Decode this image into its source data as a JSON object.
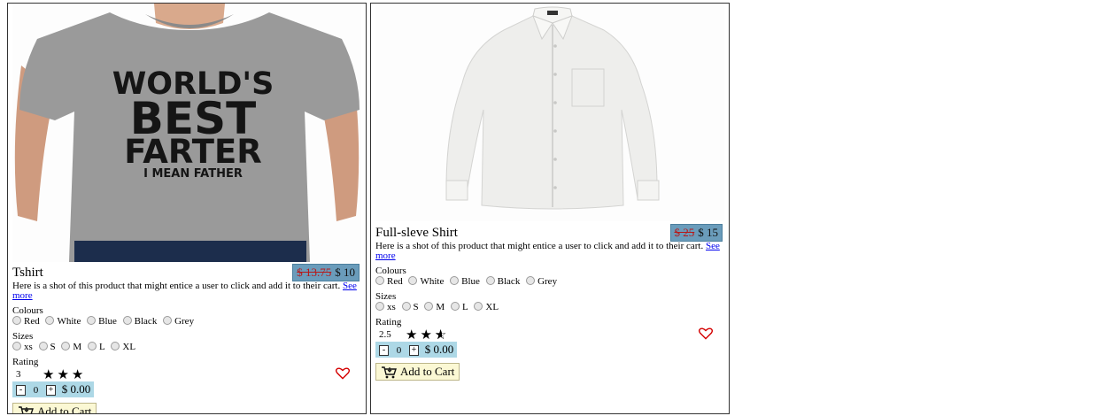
{
  "products": [
    {
      "title": "Tshirt",
      "price_old": "$ 13.75",
      "price_new": "$ 10",
      "description": "Here is a shot of this product that might entice a user to click and add it to their cart.",
      "see_more": "See more",
      "colours_label": "Colours",
      "colours": [
        "Red",
        "White",
        "Blue",
        "Black",
        "Grey"
      ],
      "sizes_label": "Sizes",
      "sizes": [
        "xs",
        "S",
        "M",
        "L",
        "XL"
      ],
      "rating_label": "Rating",
      "rating_value": "3",
      "quantity": "0",
      "total": "$ 0.00",
      "cart_label": "Add to Cart",
      "image_icon": "grey-tshirt-photo",
      "shirt_text": [
        "WORLD'S",
        "BEST",
        "FARTER",
        "I MEAN FATHER"
      ]
    },
    {
      "title": "Full-sleve Shirt",
      "price_old": "$ 25",
      "price_new": "$ 15",
      "description": "Here is a shot of this product that might entice a user to click and add it to their cart.",
      "see_more": "See more",
      "colours_label": "Colours",
      "colours": [
        "Red",
        "White",
        "Blue",
        "Black",
        "Grey"
      ],
      "sizes_label": "Sizes",
      "sizes": [
        "xs",
        "S",
        "M",
        "L",
        "XL"
      ],
      "rating_label": "Rating",
      "rating_value": "2.5",
      "quantity": "0",
      "total": "$ 0.00",
      "cart_label": "Add to Cart",
      "image_icon": "white-shirt-photo"
    }
  ],
  "colors": {
    "price_badge": "#6a9cbb",
    "old_price": "#b81818",
    "qty_bar": "#add8e6",
    "cart_button": "#fbf8d4",
    "heart": "#d40000"
  },
  "icons": [
    "star-icon",
    "half-star-icon",
    "heart-icon",
    "cart-icon",
    "minus-icon",
    "plus-icon"
  ]
}
